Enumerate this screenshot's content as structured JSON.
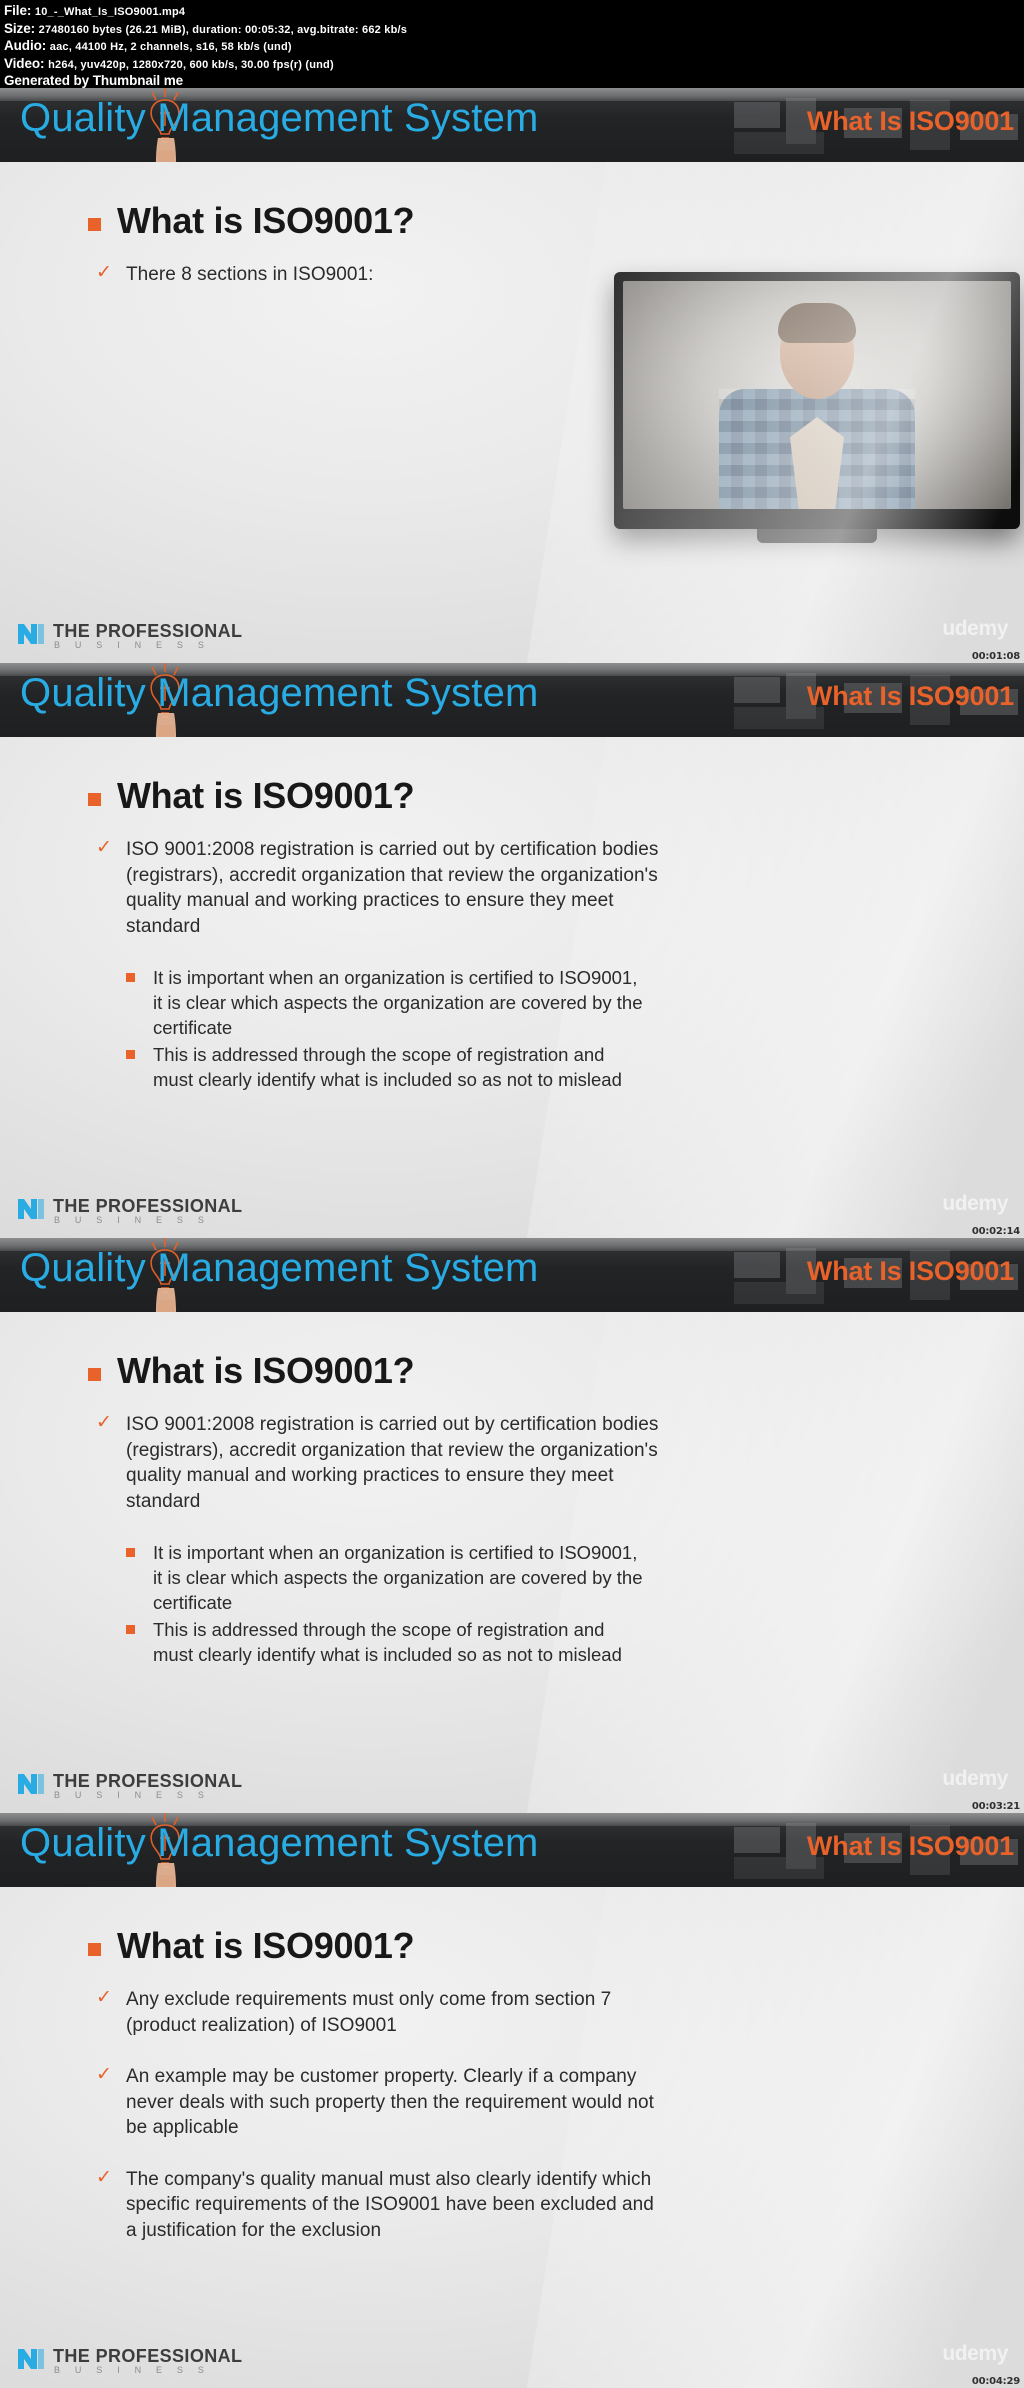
{
  "metadata": {
    "file_label": "File:",
    "file_value": "10_-_What_Is_ISO9001.mp4",
    "size_label": "Size:",
    "size_value": "27480160 bytes (26.21 MiB), duration: 00:05:32, avg.bitrate: 662 kb/s",
    "audio_label": "Audio:",
    "audio_value": "aac, 44100 Hz, 2 channels, s16, 58 kb/s (und)",
    "video_label": "Video:",
    "video_value": "h264, yuv420p, 1280x720, 600 kb/s, 30.00 fps(r) (und)",
    "generated_by": "Generated by Thumbnail me"
  },
  "colors": {
    "title_blue": "#29ace3",
    "accent_orange": "#e8622a",
    "header_dark": "#212325",
    "body_grey": "#eaeaea"
  },
  "branding": {
    "logo_main": "THE PROFESSIONAL",
    "logo_sub": "B U S I N E S S",
    "watermark": "udemy"
  },
  "frames": [
    {
      "header_title": "Quality Management System",
      "header_sub": "What Is ISO9001",
      "heading": "What is ISO9001?",
      "timestamp": "00:01:08",
      "bullets": [
        {
          "text": "There 8 sections in ISO9001:"
        }
      ],
      "sub_bullets": [],
      "has_video_overlay": true
    },
    {
      "header_title": "Quality Management System",
      "header_sub": "What Is ISO9001",
      "heading": "What is ISO9001?",
      "timestamp": "00:02:14",
      "bullets": [
        {
          "text": "ISO 9001:2008 registration is carried out by certification bodies (registrars), accredit organization that review the organization's quality manual and working practices to ensure they meet standard"
        }
      ],
      "sub_bullets": [
        {
          "text": "It is important when an organization is certified to ISO9001, it is clear which aspects the organization are covered by the certificate"
        },
        {
          "text": "This is addressed through the scope of registration and must clearly identify what is included so as not to mislead"
        }
      ],
      "has_video_overlay": false
    },
    {
      "header_title": "Quality Management System",
      "header_sub": "What Is ISO9001",
      "heading": "What is ISO9001?",
      "timestamp": "00:03:21",
      "bullets": [
        {
          "text": "ISO 9001:2008 registration is carried out by certification bodies (registrars), accredit organization that review the organization's quality manual and working practices to ensure they meet standard"
        }
      ],
      "sub_bullets": [
        {
          "text": "It is important when an organization is certified to ISO9001, it is clear which aspects the organization are covered by the certificate"
        },
        {
          "text": "This is addressed through the scope of registration and must clearly identify what is included so as not to mislead"
        }
      ],
      "has_video_overlay": false
    },
    {
      "header_title": "Quality Management System",
      "header_sub": "What Is ISO9001",
      "heading": "What is ISO9001?",
      "timestamp": "00:04:29",
      "bullets": [
        {
          "text": "Any exclude requirements must only come from section 7 (product realization) of ISO9001"
        },
        {
          "text": "An example may be customer property. Clearly if a company never deals with such property then the requirement would not be applicable"
        },
        {
          "text": "The company's quality manual must also clearly identify which specific requirements of the ISO9001 have been excluded and a justification for the exclusion"
        }
      ],
      "sub_bullets": [],
      "has_video_overlay": false
    }
  ]
}
